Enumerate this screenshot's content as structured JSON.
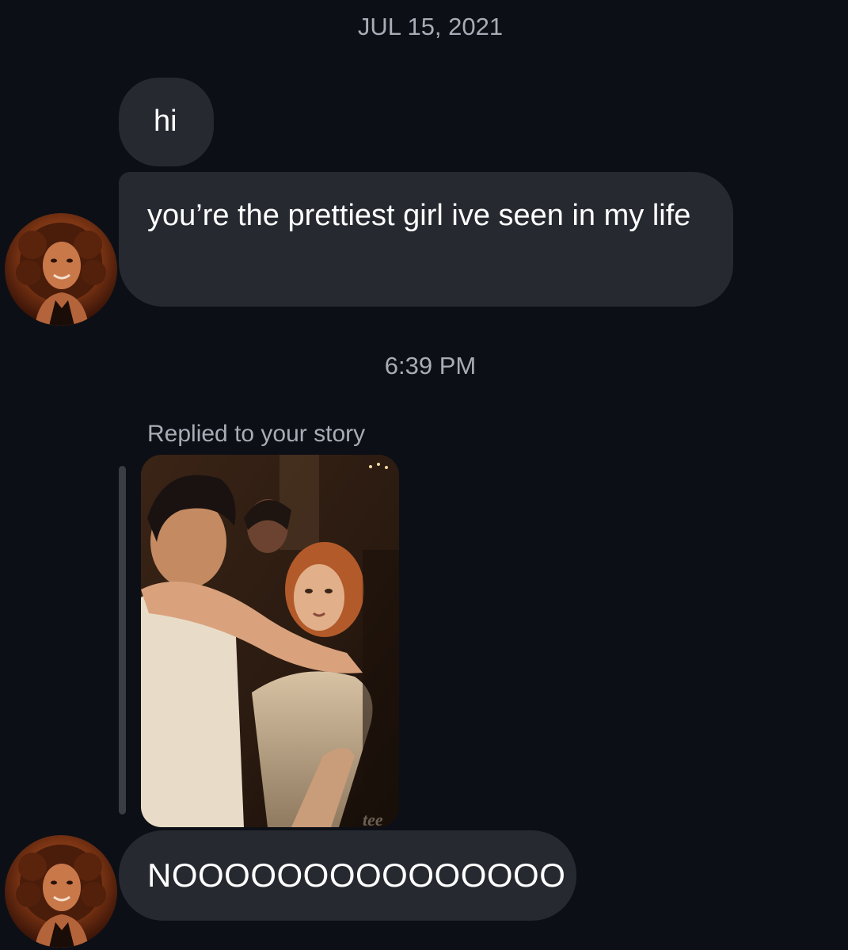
{
  "conversation": {
    "date_separator": "JUL 15, 2021",
    "time_separator": "6:39 PM",
    "messages": [
      {
        "text": "hi"
      },
      {
        "text": "you’re the prettiest girl ive seen in my life"
      },
      {
        "text": "NOOOOOOOOOOOOOOO"
      }
    ],
    "story_reply": {
      "label": "Replied to your story",
      "watermark": "tee"
    }
  },
  "colors": {
    "background": "#0d0f16",
    "bubble": "#262930",
    "secondary_text": "#a9acb6",
    "reply_bar": "#3a3d45"
  },
  "icons": {
    "avatar": "profile-photo",
    "story": "story-thumbnail-photo"
  }
}
